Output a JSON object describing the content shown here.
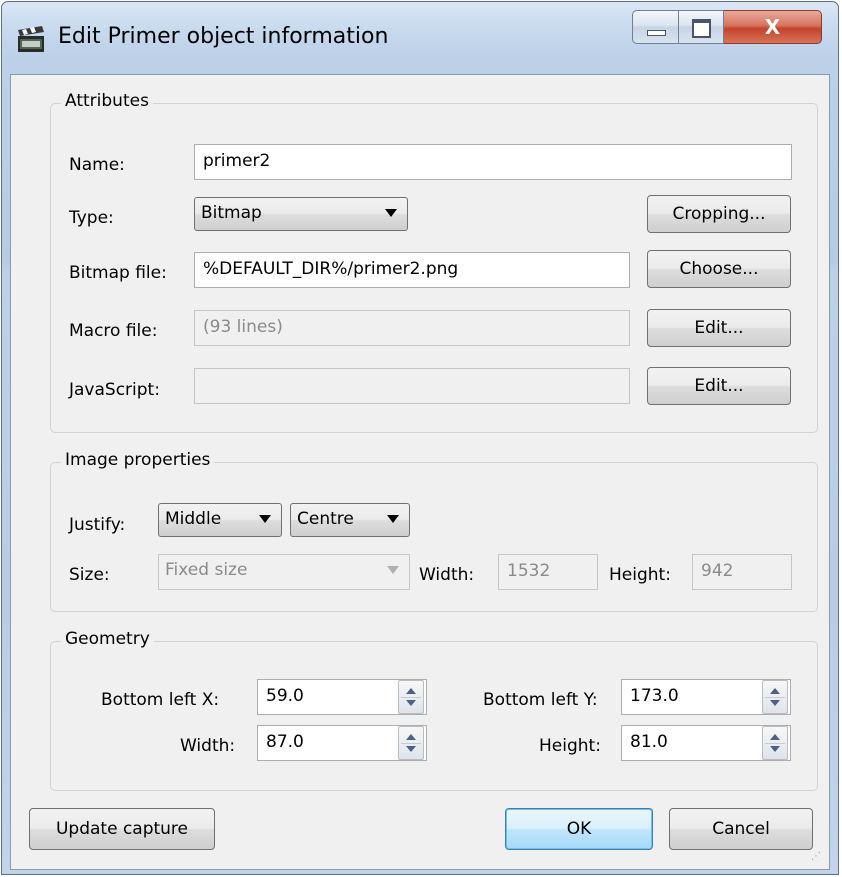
{
  "window": {
    "title": "Edit Primer object information",
    "minimize_icon": "minimize-icon",
    "maximize_icon": "maximize-icon",
    "close_glyph": "X",
    "app_icon": "clapperboard-icon"
  },
  "attributes": {
    "group_title": "Attributes",
    "name_label": "Name:",
    "name_value": "primer2",
    "type_label": "Type:",
    "type_value": "Bitmap",
    "cropping_button": "Cropping...",
    "bitmap_label": "Bitmap file:",
    "bitmap_value": "%DEFAULT_DIR%/primer2.png",
    "choose_button": "Choose...",
    "macro_label": "Macro file:",
    "macro_value": "(93 lines)",
    "macro_edit_button": "Edit...",
    "js_label": "JavaScript:",
    "js_value": "",
    "js_edit_button": "Edit..."
  },
  "image_properties": {
    "group_title": "Image properties",
    "justify_label": "Justify:",
    "justify_vertical": "Middle",
    "justify_horizontal": "Centre",
    "size_label": "Size:",
    "size_value": "Fixed size",
    "width_label": "Width:",
    "width_value": "1532",
    "height_label": "Height:",
    "height_value": "942"
  },
  "geometry": {
    "group_title": "Geometry",
    "blx_label": "Bottom left X:",
    "blx_value": "59.0",
    "bly_label": "Bottom left Y:",
    "bly_value": "173.0",
    "width_label": "Width:",
    "width_value": "87.0",
    "height_label": "Height:",
    "height_value": "81.0"
  },
  "footer": {
    "update_button": "Update capture",
    "ok_button": "OK",
    "cancel_button": "Cancel"
  }
}
